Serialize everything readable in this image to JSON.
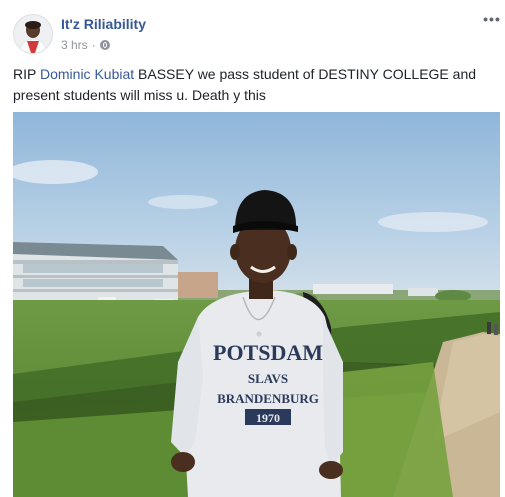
{
  "post": {
    "author": "It'z Riliability",
    "time": "3 hrs",
    "separator": "·",
    "more_label": "•••",
    "text_before": "RIP ",
    "mention": "Dominic Kubiat",
    "text_after": " BASSEY we pass student of DESTINY COLLEGE and present students will miss u. Death y this",
    "shirt_lines": [
      "POTSDAM",
      "SLAVS",
      "BRANDENBURG",
      "1970"
    ]
  },
  "icons": {
    "avatar": "profile-photo",
    "privacy": "globe-icon",
    "more": "more-options-icon"
  },
  "colors": {
    "link": "#365899",
    "meta": "#90949c",
    "text": "#1d2129"
  }
}
